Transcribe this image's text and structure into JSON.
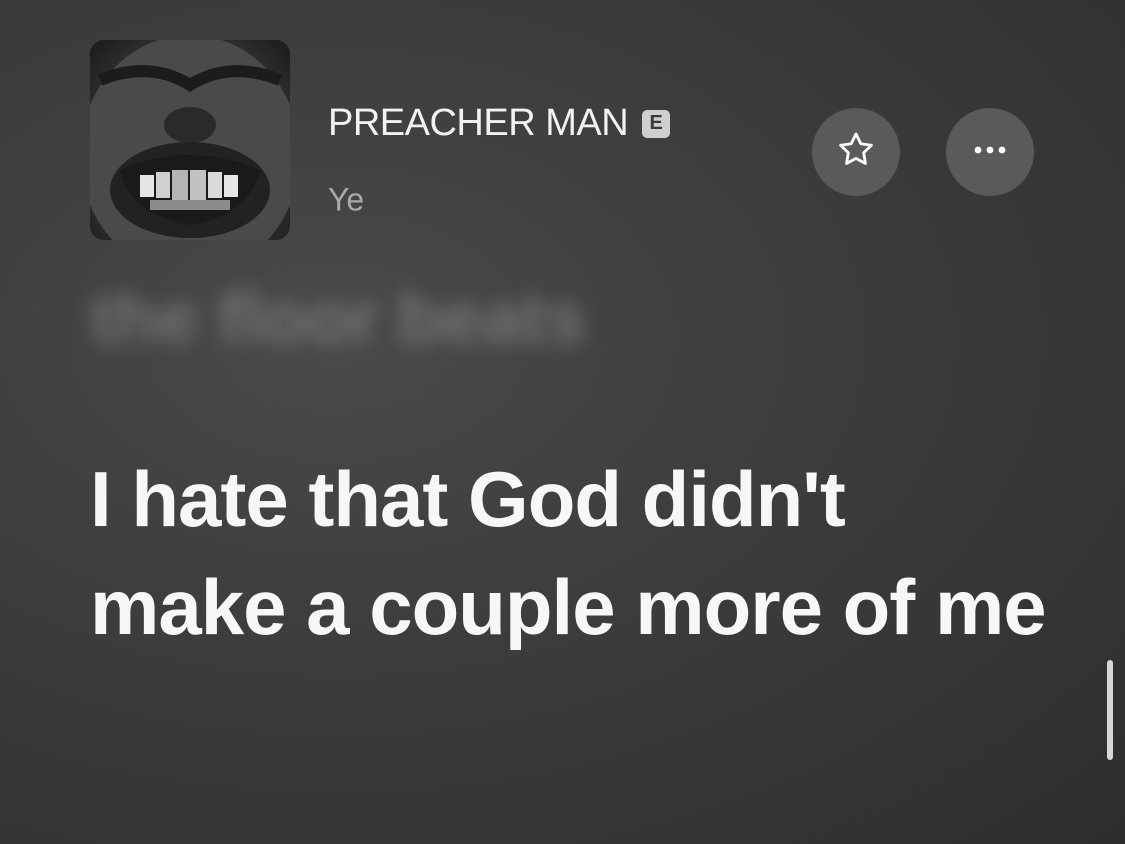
{
  "track": {
    "title": "PREACHER MAN",
    "explicit_badge": "E",
    "artist": "Ye"
  },
  "lyrics": {
    "previous_line": "the floor beats",
    "current_line": "I hate that God didn't make a couple more of me"
  },
  "icons": {
    "favorite": "star-icon",
    "more": "ellipsis-icon"
  },
  "colors": {
    "background": "#3c3c3c",
    "button": "#5a5a5a",
    "lyric_text": "#f7f7f7",
    "artist_text": "#a9a9a9"
  }
}
